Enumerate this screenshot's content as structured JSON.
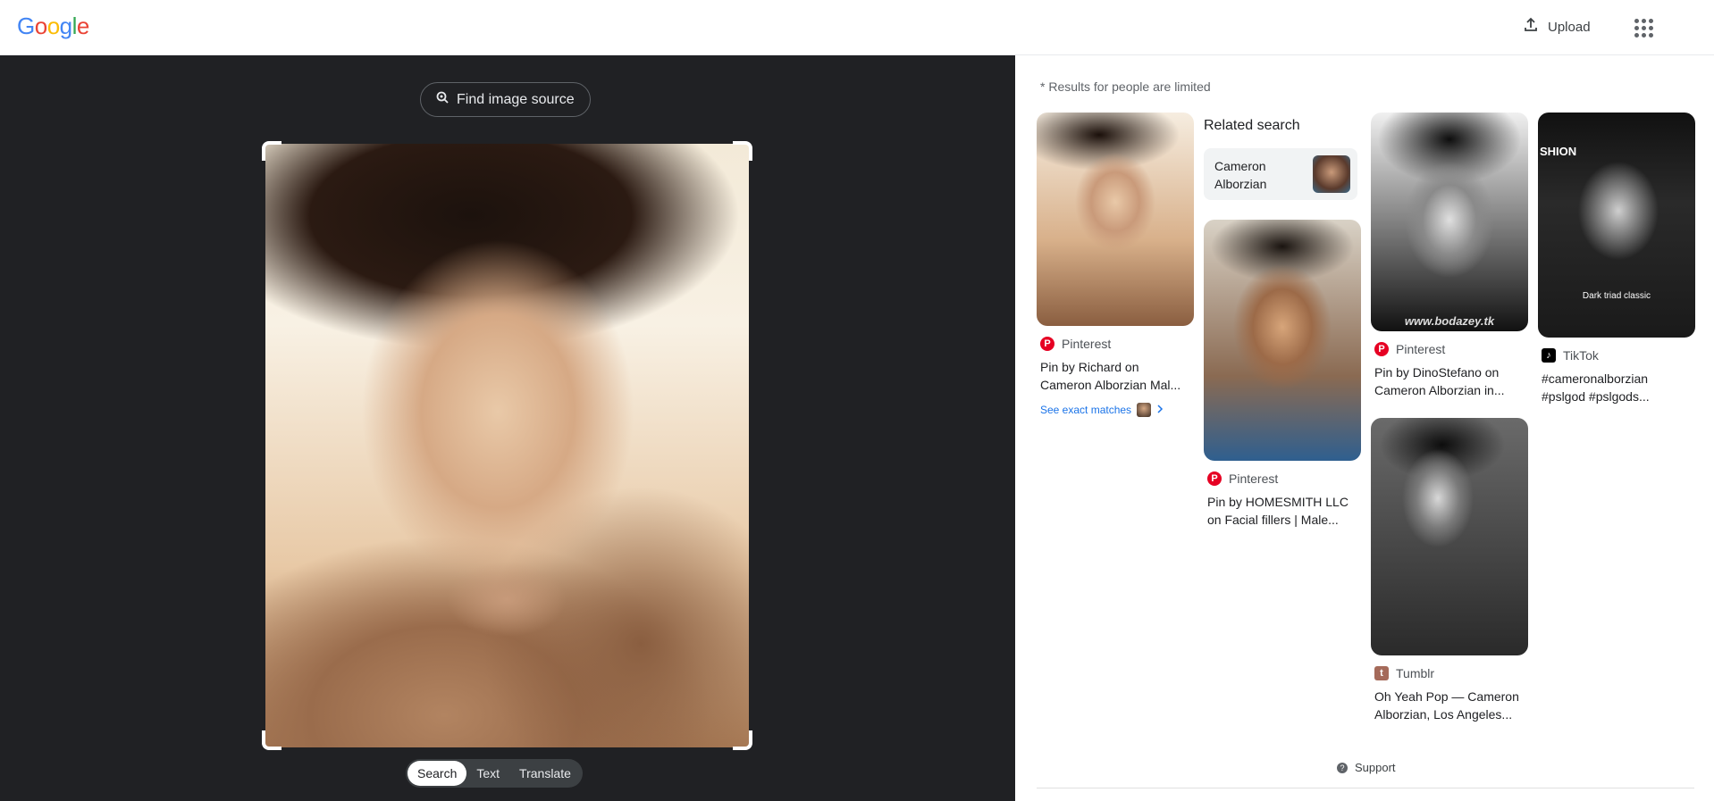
{
  "header": {
    "logo": "Google",
    "upload_label": "Upload"
  },
  "viewer": {
    "find_source_label": "Find image source",
    "modes": [
      "Search",
      "Text",
      "Translate"
    ],
    "active_mode": "Search"
  },
  "results": {
    "limit_note": "* Results for people are limited",
    "related": {
      "title": "Related search",
      "chip_label": "Cameron Alborzian"
    },
    "cards": [
      {
        "source": "Pinterest",
        "title_line1": "Pin by Richard on",
        "title_line2": "Cameron Alborzian Mal..."
      },
      {
        "source": "Pinterest",
        "title_line1": "Pin by HOMESMITH LLC",
        "title_line2": "on Facial fillers | Male..."
      },
      {
        "source": "Pinterest",
        "title_line1": "Pin by DinoStefano on",
        "title_line2": "Cameron Alborzian in...",
        "watermark": "www.bodazey.tk"
      },
      {
        "source": "TikTok",
        "title_line1": "#cameronalborzian",
        "title_line2": "#pslgod #pslgods...",
        "overlay_text": "Dark triad classic",
        "brand_text": "SHION"
      },
      {
        "source": "Tumblr",
        "title_line1": "Oh Yeah Pop — Cameron",
        "title_line2": "Alborzian, Los Angeles..."
      }
    ],
    "exact_matches_label": "See exact matches",
    "support_label": "Support"
  },
  "colors": {
    "viewer_bg": "#202124",
    "link_blue": "#1a73e8",
    "pinterest_red": "#e60023"
  }
}
